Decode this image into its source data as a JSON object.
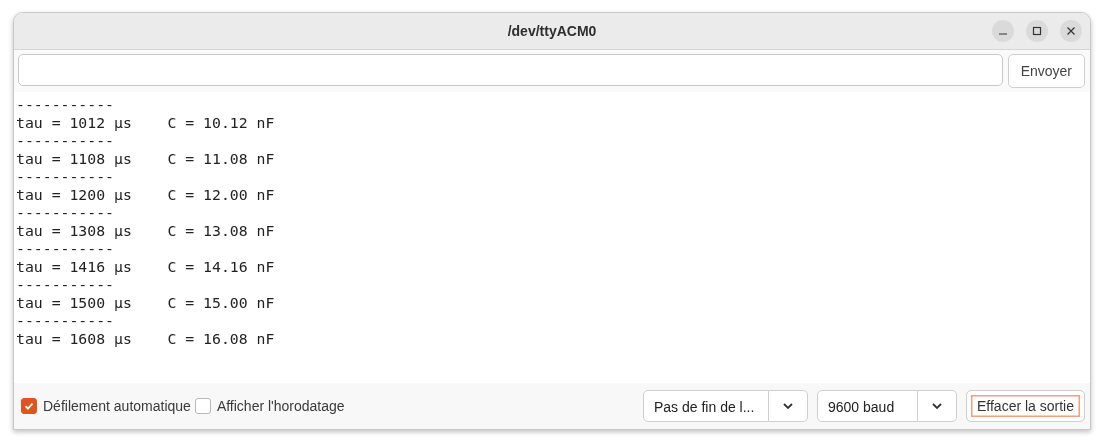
{
  "window": {
    "title": "/dev/ttyACM0"
  },
  "send": {
    "button": "Envoyer"
  },
  "output": [
    "-----------",
    "tau = 1012 µs    C = 10.12 nF",
    "-----------",
    "tau = 1108 µs    C = 11.08 nF",
    "-----------",
    "tau = 1200 µs    C = 12.00 nF",
    "-----------",
    "tau = 1308 µs    C = 13.08 nF",
    "-----------",
    "tau = 1416 µs    C = 14.16 nF",
    "-----------",
    "tau = 1500 µs    C = 15.00 nF",
    "-----------",
    "tau = 1608 µs    C = 16.08 nF"
  ],
  "options": [
    {
      "label": "Défilement automatique",
      "checked": true
    },
    {
      "label": "Afficher l'horodatage",
      "checked": false
    }
  ],
  "line_ending": {
    "value": "Pas de fin de l..."
  },
  "baud": {
    "value": "9600 baud"
  },
  "clear": {
    "label": "Effacer la sortie",
    "focused": true
  }
}
